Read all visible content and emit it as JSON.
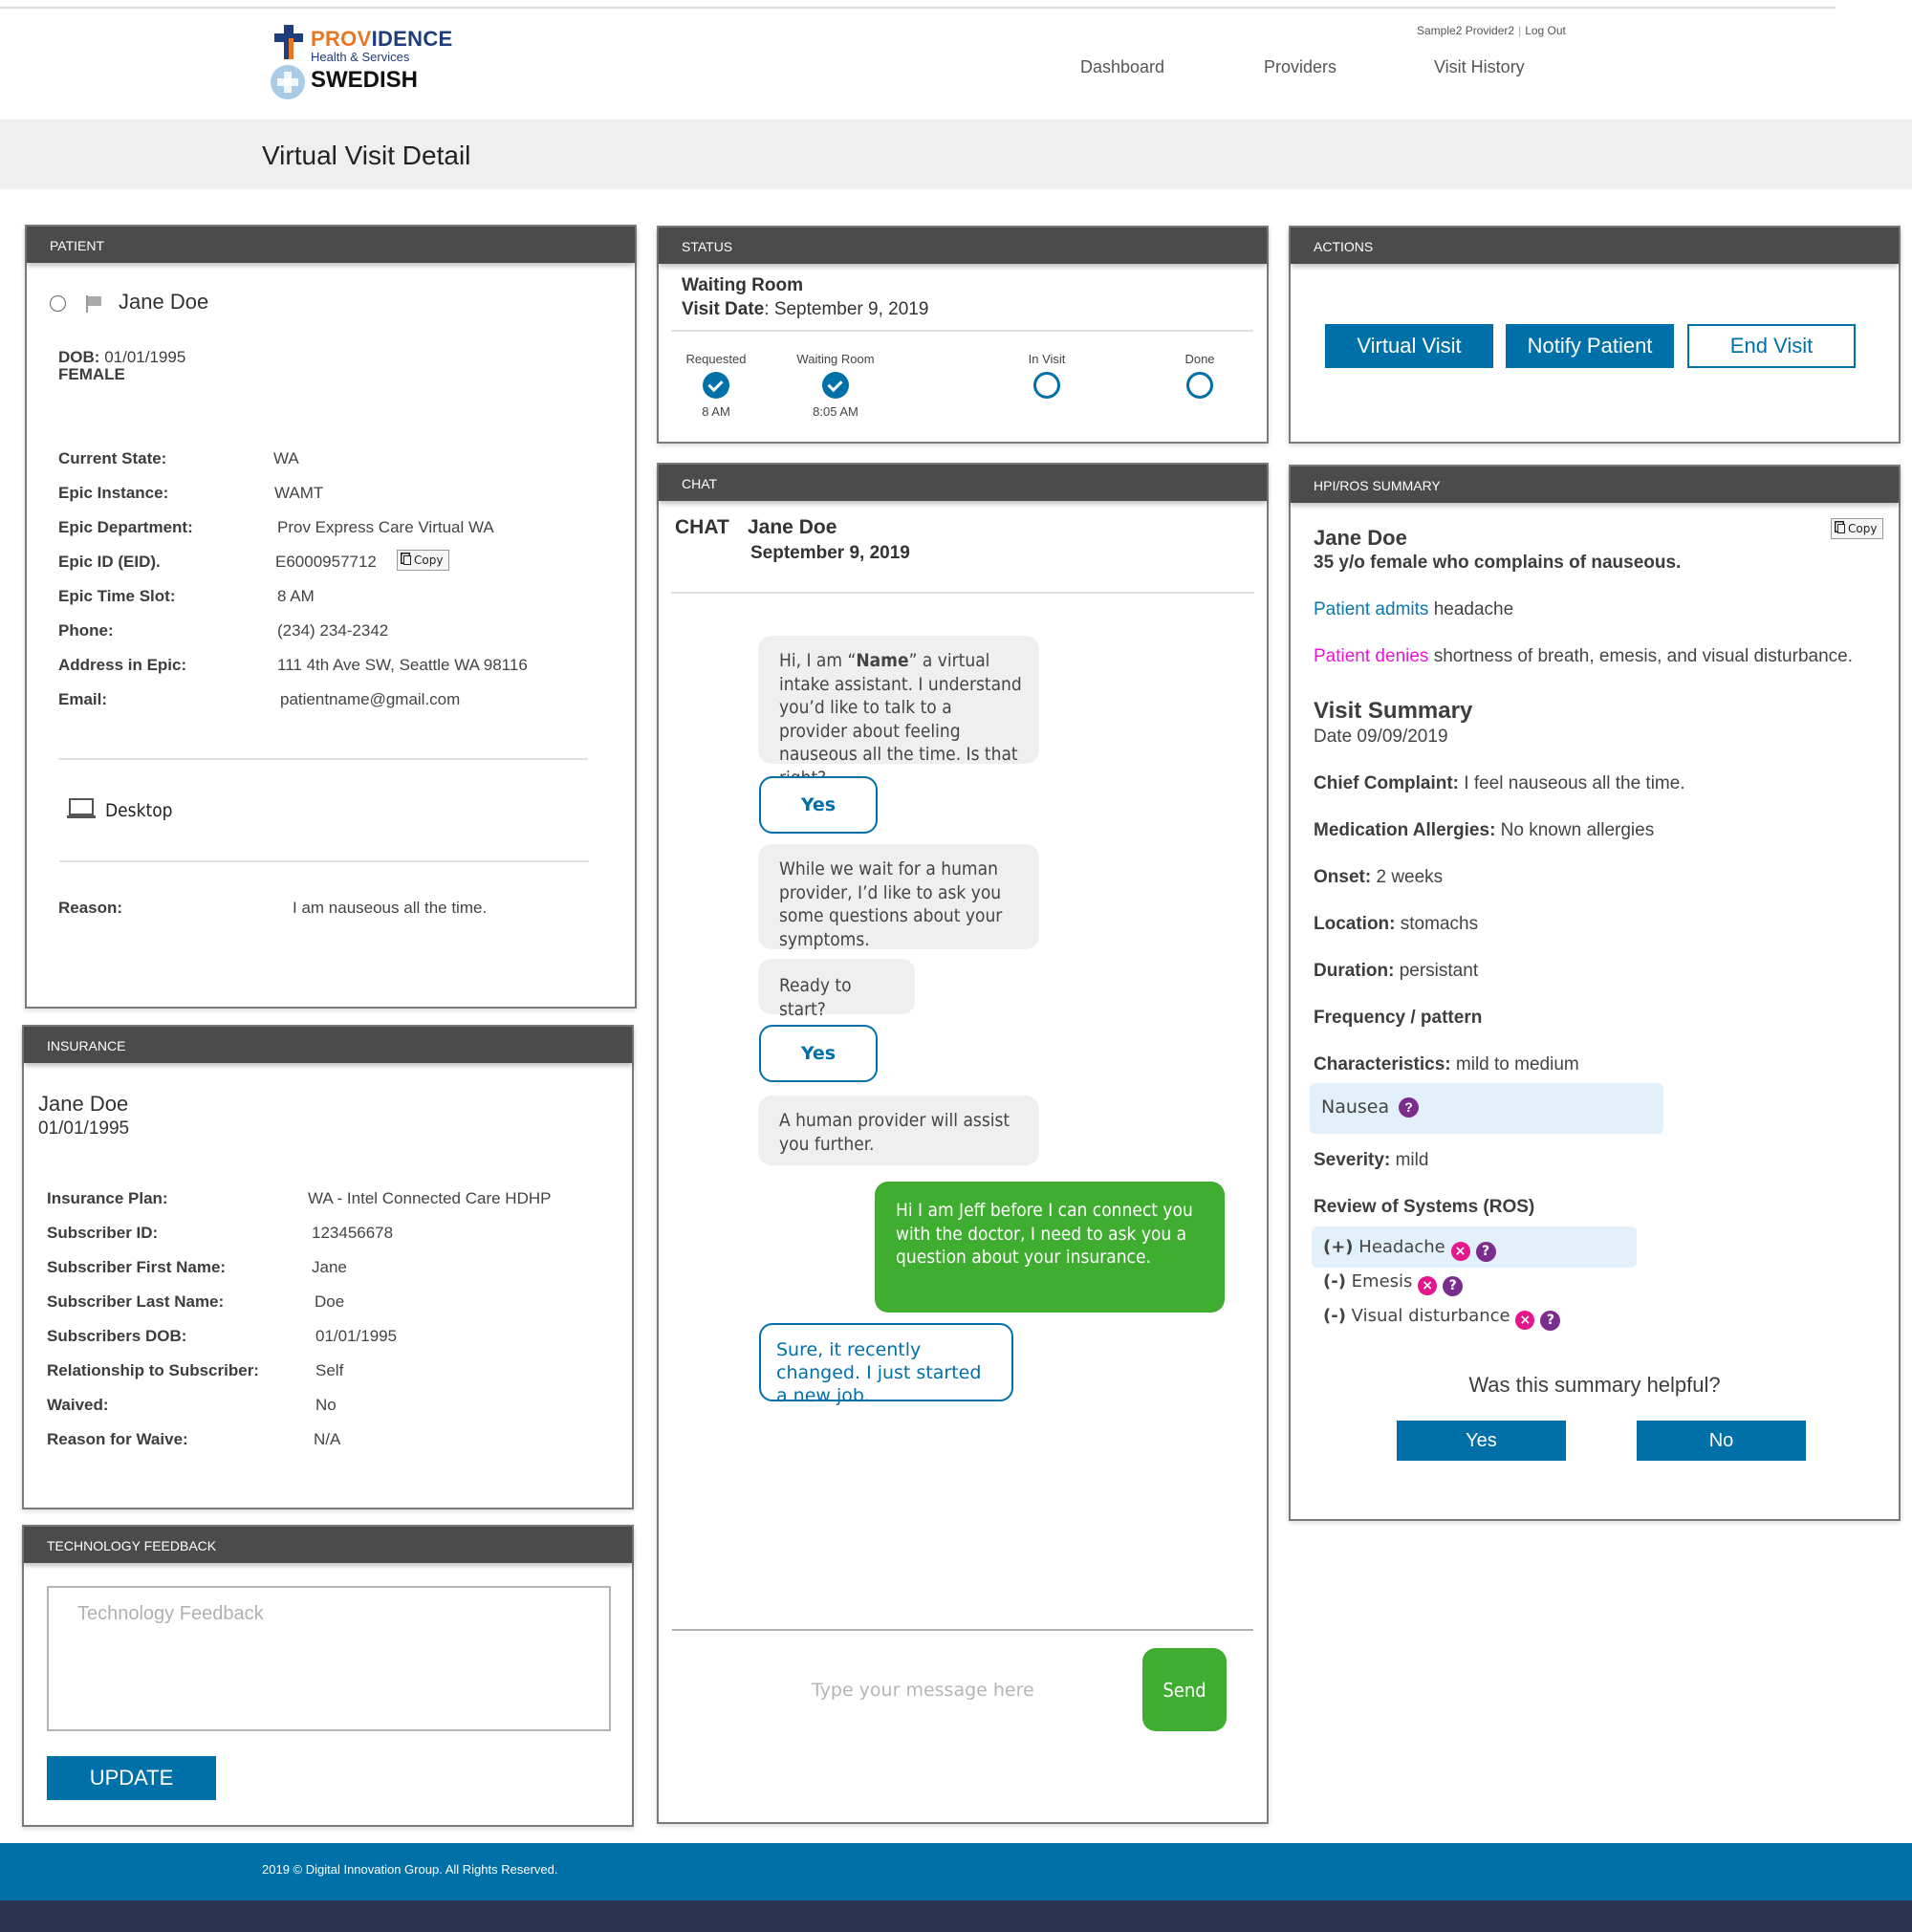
{
  "header": {
    "logo": {
      "brand_primary_a": "PROV",
      "brand_primary_b": "IDENCE",
      "brand_sub": "Health & Services",
      "brand_secondary": "SWEDISH"
    },
    "user_name": "Sample2 Provider2",
    "logout_label": "Log Out",
    "nav": [
      "Dashboard",
      "Providers",
      "Visit History"
    ]
  },
  "page_title": "Virtual Visit Detail",
  "patient": {
    "section_title": "PATIENT",
    "name": "Jane Doe",
    "dob_label": "DOB:",
    "dob": "01/01/1995",
    "sex": "FEMALE",
    "fields": [
      {
        "label": "Current State:",
        "value": "WA"
      },
      {
        "label": "Epic Instance:",
        "value": "WAMT"
      },
      {
        "label": "Epic Department:",
        "value": "Prov Express Care Virtual WA"
      },
      {
        "label": "Epic ID (EID).",
        "value": "E6000957712"
      },
      {
        "label": "Epic Time Slot:",
        "value": "8 AM"
      },
      {
        "label": "Phone:",
        "value": "(234) 234-2342"
      },
      {
        "label": "Address in Epic:",
        "value": "111 4th Ave SW, Seattle WA 98116"
      },
      {
        "label": "Email:",
        "value": "patientname@gmail.com"
      }
    ],
    "copy_label": "Copy",
    "device": "Desktop",
    "reason_label": "Reason:",
    "reason": "I am nauseous all the time."
  },
  "insurance": {
    "section_title": "INSURANCE",
    "name": "Jane Doe",
    "dob": "01/01/1995",
    "fields": [
      {
        "label": "Insurance Plan:",
        "value": "WA - Intel Connected Care HDHP"
      },
      {
        "label": "Subscriber ID:",
        "value": "123456678"
      },
      {
        "label": "Subscriber First Name:",
        "value": "Jane"
      },
      {
        "label": "Subscriber Last Name:",
        "value": "Doe"
      },
      {
        "label": "Subscribers DOB:",
        "value": "01/01/1995"
      },
      {
        "label": "Relationship to Subscriber:",
        "value": "Self"
      },
      {
        "label": "Waived:",
        "value": "No"
      },
      {
        "label": "Reason for Waive:",
        "value": "N/A"
      }
    ]
  },
  "tech_feedback": {
    "section_title": "TECHNOLOGY FEEDBACK",
    "placeholder": "Technology Feedback",
    "value": "",
    "update_label": "UPDATE"
  },
  "status": {
    "section_title": "STATUS",
    "current": "Waiting Room",
    "visit_date_label": "Visit Date",
    "visit_date": "September 9, 2019",
    "steps": [
      {
        "label": "Requested",
        "time": "8 AM",
        "complete": true
      },
      {
        "label": "Waiting Room",
        "time": "8:05 AM",
        "complete": true
      },
      {
        "label": "In Visit",
        "time": "",
        "complete": false
      },
      {
        "label": "Done",
        "time": "",
        "complete": false
      }
    ]
  },
  "chat": {
    "section_title": "CHAT",
    "heading": "CHAT",
    "patient_name": "Jane Doe",
    "date": "September 9, 2019",
    "messages": [
      {
        "type": "bot",
        "pre": "Hi, I am “",
        "bold": "Name",
        "post": "” a virtual intake assistant.  I understand you’d like to talk to a provider about feeling nauseous all the time. Is that right?"
      },
      {
        "type": "quick_reply",
        "text": "Yes"
      },
      {
        "type": "bot",
        "text": "While we wait for a human provider, I’d like to ask you some questions about your symptoms."
      },
      {
        "type": "bot",
        "text": "Ready to start?"
      },
      {
        "type": "quick_reply",
        "text": "Yes"
      },
      {
        "type": "bot",
        "text": "A human provider will assist you further."
      },
      {
        "type": "provider",
        "text": "Hi I am Jeff before I can connect you with the doctor, I need to ask you a question about your insurance."
      },
      {
        "type": "patient",
        "text": "Sure, it recently changed. I just started a new job."
      }
    ],
    "input_placeholder": "Type your message here",
    "input_value": "",
    "send_label": "Send"
  },
  "actions": {
    "section_title": "ACTIONS",
    "buttons": [
      "Virtual Visit",
      "Notify Patient",
      "End Visit"
    ]
  },
  "hpi": {
    "section_title": "HPI/ROS SUMMARY",
    "copy_label": "Copy",
    "name": "Jane Doe",
    "summary": "35 y/o female who complains of nauseous.",
    "admits_label": "Patient admits",
    "admits": "headache",
    "denies_label": "Patient denies",
    "denies": "shortness of breath, emesis, and visual disturbance.",
    "visit_summary_title": "Visit Summary",
    "visit_summary_date": "Date 09/09/2019",
    "fields": [
      {
        "label": "Chief Complaint:",
        "value": " I feel nauseous all the time."
      },
      {
        "label": "Medication Allergies:",
        "value": "No known allergies"
      },
      {
        "label": "Onset:",
        "value": "2 weeks"
      },
      {
        "label": "Location:",
        "value": "stomachs"
      },
      {
        "label": "Duration:",
        "value": "persistant"
      },
      {
        "label": "Frequency / pattern",
        "value": ""
      },
      {
        "label": "Characteristics:",
        "value": "mild to medium"
      }
    ],
    "characteristic_tag": "Nausea",
    "severity_label": "Severity:",
    "severity": "mild",
    "ros_title": "Review of Systems (ROS)",
    "ros": [
      {
        "sign": "(+)",
        "name": "Headache",
        "highlighted": true
      },
      {
        "sign": "(-)",
        "name": "Emesis",
        "highlighted": false
      },
      {
        "sign": "(-)",
        "name": "Visual disturbance",
        "highlighted": false
      }
    ],
    "feedback_question": "Was this summary helpful?",
    "yes_label": "Yes",
    "no_label": "No"
  },
  "footer": {
    "copyright": "2019 © Digital Innovation Group. All Rights Reserved."
  },
  "colors": {
    "brand_blue": "#0070a8",
    "provider_green": "#3fad2f",
    "admits_blue": "#0a77b0",
    "denies_magenta": "#e619d2",
    "remove_pink": "#e5168c",
    "help_purple": "#7b2d8e",
    "panel_header": "#4b4b4b",
    "footer_navy": "#28334f"
  }
}
